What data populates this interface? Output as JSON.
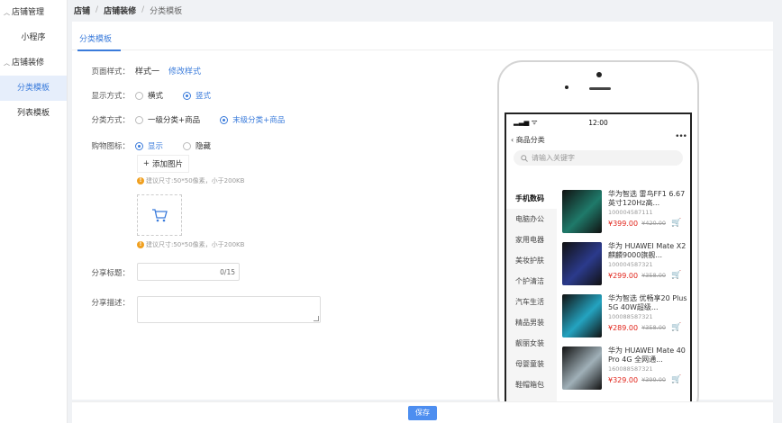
{
  "sidebar": {
    "groups": [
      {
        "label": "店铺管理",
        "items": [
          {
            "label": "小程序"
          }
        ]
      },
      {
        "label": "店铺装修",
        "items": [
          {
            "label": "分类模板"
          },
          {
            "label": "列表模板"
          }
        ]
      }
    ]
  },
  "breadcrumb": [
    "店铺",
    "店铺装修",
    "分类模板"
  ],
  "tab": "分类模板",
  "form": {
    "page_style": {
      "label": "页面样式：",
      "value": "样式一",
      "action": "修改样式"
    },
    "display_mode": {
      "label": "显示方式：",
      "options": [
        "横式",
        "竖式"
      ],
      "selected": "竖式"
    },
    "category_mode": {
      "label": "分类方式：",
      "options": [
        "一级分类+商品",
        "末级分类+商品"
      ],
      "selected": "末级分类+商品"
    },
    "cart_icon": {
      "label": "购物图标：",
      "options": [
        "显示",
        "隐藏"
      ],
      "selected": "显示",
      "add_label": "添加图片",
      "hint": "建议尺寸:50*50像素，小于200KB"
    },
    "share_title": {
      "label": "分享标题：",
      "counter": "0/15"
    },
    "share_desc": {
      "label": "分享描述："
    }
  },
  "preview": {
    "time": "12:00",
    "nav_title": "商品分类",
    "search_placeholder": "请输入关键字",
    "categories": [
      "手机数码",
      "电脑办公",
      "家用电器",
      "美妆护肤",
      "个护清洁",
      "汽车生活",
      "精品男装",
      "靓丽女装",
      "母婴童装",
      "鞋帽箱包"
    ],
    "products": [
      {
        "name": "华为智选 雷鸟FF1 6.67英寸120Hz高...",
        "sku": "100004587111",
        "price": "¥399.00",
        "old": "¥420.00",
        "color": "#1f7a6a"
      },
      {
        "name": "华为 HUAWEI Mate X2 麒麟9000旗舰...",
        "sku": "100004587321",
        "price": "¥299.00",
        "old": "¥358.00",
        "color": "#2b3a8c"
      },
      {
        "name": "华为智选 优畅享20 Plus 5G 40W超级...",
        "sku": "100088587321",
        "price": "¥289.00",
        "old": "¥358.00",
        "color": "#24a3c0"
      },
      {
        "name": "华为 HUAWEI Mate 40 Pro 4G 全网通...",
        "sku": "160088587321",
        "price": "¥329.00",
        "old": "¥399.00",
        "color": "#a0b0b8"
      }
    ]
  },
  "footer": {
    "save": "保存"
  },
  "colors": {
    "accent": "#3a7bdb",
    "price": "#e1251b"
  }
}
